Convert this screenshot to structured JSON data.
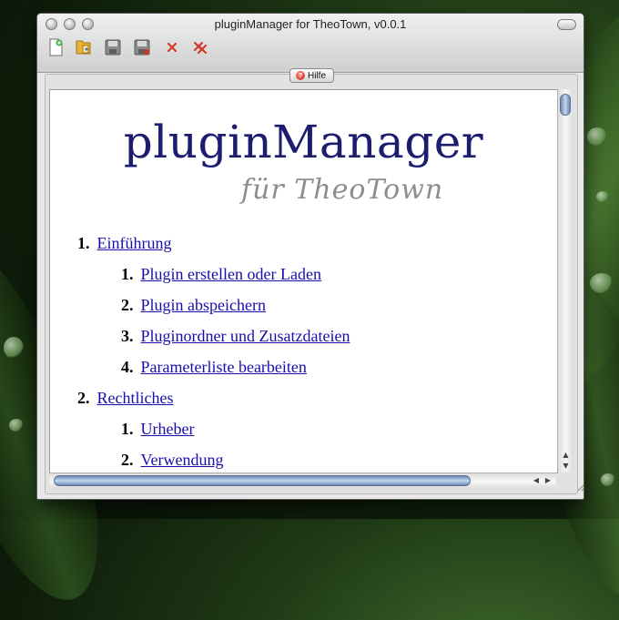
{
  "window": {
    "title": "pluginManager for TheoTown, v0.0.1"
  },
  "toolbar": {
    "items": [
      {
        "icon": "new-file-icon",
        "color": "#4caf50"
      },
      {
        "icon": "open-folder-icon",
        "color": "#e8b23a"
      },
      {
        "icon": "save-icon",
        "color": "#7d7d7d"
      },
      {
        "icon": "save-as-icon",
        "color": "#7d7d7d"
      },
      {
        "icon": "close-icon",
        "color": "#d23a2a"
      },
      {
        "icon": "close-all-icon",
        "color": "#d23a2a"
      }
    ]
  },
  "help_button": {
    "label": "Hilfe",
    "icon": "help-icon"
  },
  "logo": {
    "main": "pluginManager",
    "sub": "für TheoTown"
  },
  "toc": [
    {
      "num": "1.",
      "label": "Einführung",
      "level": 1
    },
    {
      "num": "1.",
      "label": "Plugin erstellen oder Laden",
      "level": 2
    },
    {
      "num": "2.",
      "label": "Plugin abspeichern",
      "level": 2
    },
    {
      "num": "3.",
      "label": "Pluginordner und Zusatzdateien",
      "level": 2
    },
    {
      "num": "4.",
      "label": "Parameterliste bearbeiten",
      "level": 2
    },
    {
      "num": "2.",
      "label": "Rechtliches",
      "level": 1
    },
    {
      "num": "1.",
      "label": "Urheber",
      "level": 2
    },
    {
      "num": "2.",
      "label": "Verwendung",
      "level": 2
    }
  ],
  "colors": {
    "link": "#1a0dab",
    "logo_main": "#1d1d6f",
    "logo_sub": "#8d8d8d",
    "scroll_thumb": "#8aa6d6"
  }
}
